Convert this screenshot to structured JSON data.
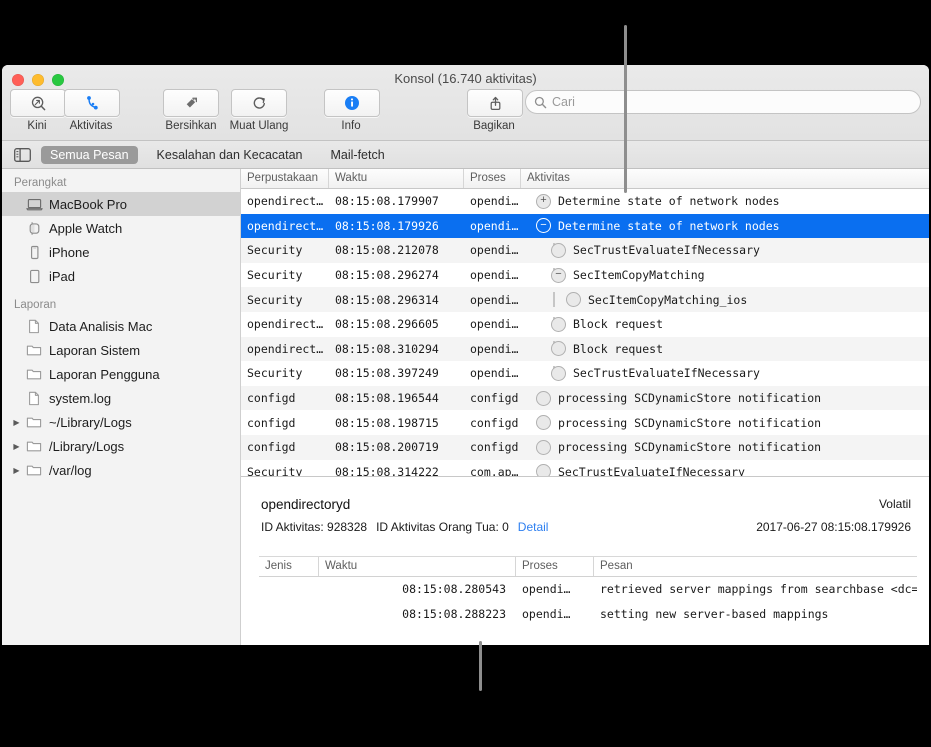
{
  "window": {
    "title": "Konsol (16.740 aktivitas)",
    "traffic_lights": [
      "close",
      "minimize",
      "zoom"
    ]
  },
  "toolbar": {
    "items": [
      {
        "label": "Kini",
        "icon": "magnifier-arrow-icon"
      },
      {
        "label": "Aktivitas",
        "icon": "activity-nodes-icon"
      },
      {
        "label": "Bersihkan",
        "icon": "clear-broom-icon"
      },
      {
        "label": "Muat Ulang",
        "icon": "reload-icon"
      },
      {
        "label": "Info",
        "icon": "info-circle-icon"
      },
      {
        "label": "Bagikan",
        "icon": "share-icon"
      }
    ],
    "search": {
      "placeholder": "Cari",
      "value": "",
      "icon": "search-icon"
    }
  },
  "scopebar": {
    "sidebar_toggle_icon": "sidebar-toggle-icon",
    "tabs": [
      {
        "label": "Semua Pesan",
        "active": true
      },
      {
        "label": "Kesalahan dan Kecacatan",
        "active": false
      },
      {
        "label": "Mail-fetch",
        "active": false
      }
    ]
  },
  "sidebar": {
    "sections": [
      {
        "header": "Perangkat",
        "items": [
          {
            "label": "MacBook Pro",
            "icon": "laptop-icon",
            "selected": true,
            "twisty": false
          },
          {
            "label": "Apple Watch",
            "icon": "watch-icon",
            "selected": false,
            "twisty": false
          },
          {
            "label": "iPhone",
            "icon": "iphone-icon",
            "selected": false,
            "twisty": false
          },
          {
            "label": "iPad",
            "icon": "ipad-icon",
            "selected": false,
            "twisty": false
          }
        ]
      },
      {
        "header": "Laporan",
        "items": [
          {
            "label": "Data Analisis Mac",
            "icon": "document-icon",
            "selected": false,
            "twisty": false
          },
          {
            "label": "Laporan Sistem",
            "icon": "folder-icon",
            "selected": false,
            "twisty": false
          },
          {
            "label": "Laporan Pengguna",
            "icon": "folder-icon",
            "selected": false,
            "twisty": false
          },
          {
            "label": "system.log",
            "icon": "document-icon",
            "selected": false,
            "twisty": false
          },
          {
            "label": "~/Library/Logs",
            "icon": "folder-icon",
            "selected": false,
            "twisty": true
          },
          {
            "label": "/Library/Logs",
            "icon": "folder-icon",
            "selected": false,
            "twisty": true
          },
          {
            "label": "/var/log",
            "icon": "folder-icon",
            "selected": false,
            "twisty": true
          }
        ]
      }
    ]
  },
  "log_table": {
    "columns": [
      "Perpustakaan",
      "Waktu",
      "Proses",
      "Aktivitas"
    ],
    "rows": [
      {
        "library": "opendirect…",
        "time": "08:15:08.179907",
        "process": "opendi…",
        "activity": "Determine state of network nodes",
        "indent": 0,
        "bullet": "plus",
        "selected": false
      },
      {
        "library": "opendirect…",
        "time": "08:15:08.179926",
        "process": "opendi…",
        "activity": "Determine state of network nodes",
        "indent": 0,
        "bullet": "minus",
        "selected": true
      },
      {
        "library": "Security",
        "time": "08:15:08.212078",
        "process": "opendi…",
        "activity": "SecTrustEvaluateIfNecessary",
        "indent": 1,
        "bullet": "none",
        "selected": false
      },
      {
        "library": "Security",
        "time": "08:15:08.296274",
        "process": "opendi…",
        "activity": "SecItemCopyMatching",
        "indent": 1,
        "bullet": "minus",
        "selected": false
      },
      {
        "library": "Security",
        "time": "08:15:08.296314",
        "process": "opendi…",
        "activity": "SecItemCopyMatching_ios",
        "indent": 2,
        "bullet": "none",
        "selected": false
      },
      {
        "library": "opendirect…",
        "time": "08:15:08.296605",
        "process": "opendi…",
        "activity": "Block request",
        "indent": 1,
        "bullet": "none",
        "selected": false
      },
      {
        "library": "opendirect…",
        "time": "08:15:08.310294",
        "process": "opendi…",
        "activity": "Block request",
        "indent": 1,
        "bullet": "none",
        "selected": false
      },
      {
        "library": "Security",
        "time": "08:15:08.397249",
        "process": "opendi…",
        "activity": "SecTrustEvaluateIfNecessary",
        "indent": 1,
        "bullet": "none",
        "selected": false
      },
      {
        "library": "configd",
        "time": "08:15:08.196544",
        "process": "configd",
        "activity": "processing SCDynamicStore notification",
        "indent": 0,
        "bullet": "none",
        "selected": false
      },
      {
        "library": "configd",
        "time": "08:15:08.198715",
        "process": "configd",
        "activity": "processing SCDynamicStore notification",
        "indent": 0,
        "bullet": "none",
        "selected": false
      },
      {
        "library": "configd",
        "time": "08:15:08.200719",
        "process": "configd",
        "activity": "processing SCDynamicStore notification",
        "indent": 0,
        "bullet": "none",
        "selected": false
      },
      {
        "library": "Security",
        "time": "08:15:08.314222",
        "process": "com.ap…",
        "activity": "SecTrustEvaluateIfNecessary",
        "indent": 0,
        "bullet": "none",
        "selected": false
      }
    ]
  },
  "detail": {
    "title": "opendirectoryd",
    "volatile_label": "Volatil",
    "activity_id_label": "ID Aktivitas: 928328",
    "parent_activity_id_label": "ID Aktivitas Orang Tua: 0",
    "detail_link": "Detail",
    "timestamp": "2017-06-27 08:15:08.179926",
    "columns": [
      "Jenis",
      "Waktu",
      "Proses",
      "Pesan"
    ],
    "rows": [
      {
        "kind": "",
        "time": "08:15:08.280543",
        "process": "opendi…",
        "message": "retrieved server mappings from searchbase <dc=apple…"
      },
      {
        "kind": "",
        "time": "08:15:08.288223",
        "process": "opendi…",
        "message": "setting new server-based mappings"
      }
    ]
  },
  "colors": {
    "selection_blue": "#0a6ff0",
    "link_blue": "#2d7ff0",
    "accent_info": "#1a7ef5",
    "callout_grey": "#8e8e8e"
  }
}
